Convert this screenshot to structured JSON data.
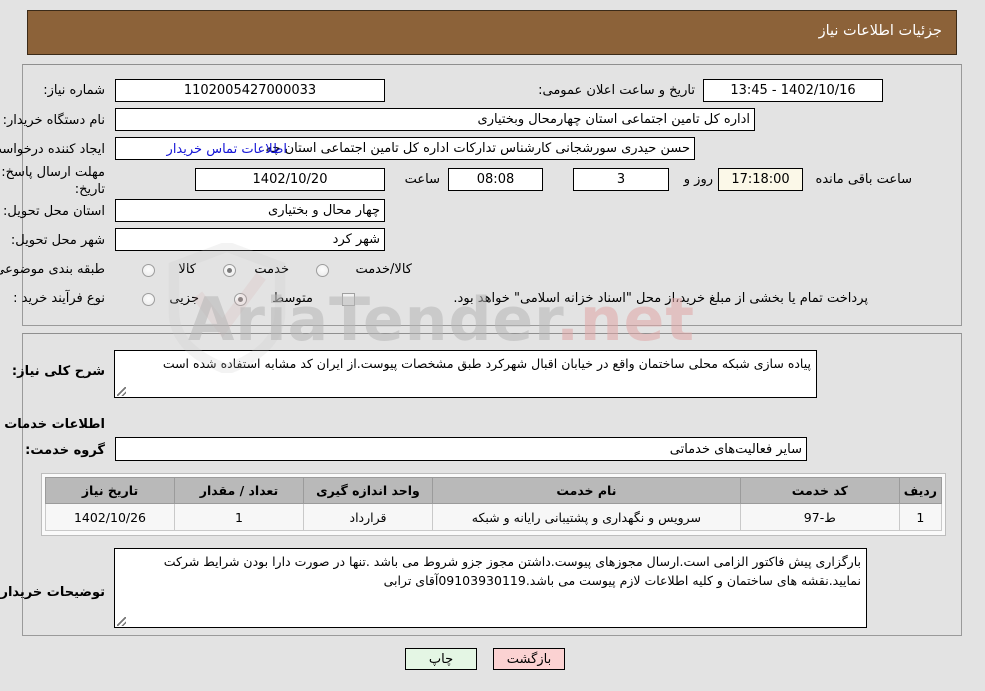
{
  "header": {
    "title": "جزئیات اطلاعات نیاز"
  },
  "watermark": {
    "text": "AriaTender",
    "suffix": ".net"
  },
  "form": {
    "need_number_label": "شماره نیاز:",
    "need_number_value": "1102005427000033",
    "announce_label": "تاریخ و ساعت اعلان عمومی:",
    "announce_value": "1402/10/16 - 13:45",
    "buyer_org_label": "نام دستگاه خریدار:",
    "buyer_org_value": "اداره کل تامین اجتماعی استان چهارمحال وبختیاری",
    "creator_label": "ایجاد کننده درخواست:",
    "creator_value": "حسن حیدری سورشجانی کارشناس تدارکات اداره کل تامین اجتماعی استان چه",
    "contact_link": "اطلاعات تماس خریدار",
    "deadline_label_1": "مهلت ارسال پاسخ: تا",
    "deadline_label_2": "تاریخ:",
    "deadline_date": "1402/10/20",
    "deadline_time_label": "ساعت",
    "deadline_time": "08:08",
    "days_left": "3",
    "days_label": "روز و",
    "hours_left": "17:18:00",
    "hours_label": "ساعت باقی مانده",
    "province_label": "استان محل تحویل:",
    "province_value": "چهار محال و بختیاری",
    "city_label": "شهر محل تحویل:",
    "city_value": "شهر کرد",
    "classification_label": "طبقه بندی موضوعی:",
    "classification_options": [
      "کالا",
      "خدمت",
      "کالا/خدمت"
    ],
    "classification_selected": "خدمت",
    "process_label": "نوع فرآیند خرید :",
    "process_options": [
      "جزیی",
      "متوسط"
    ],
    "process_selected": "متوسط",
    "treasury_note": "پرداخت تمام یا بخشی از مبلغ خرید،از محل \"اسناد خزانه اسلامی\" خواهد بود.",
    "treasury_checked": false
  },
  "description": {
    "label": "شرح کلی نیاز:",
    "value": "پیاده سازی شبکه محلی ساختمان واقع در خیابان اقبال شهرکرد طبق مشخصات پیوست.از ایران کد مشابه استفاده شده است",
    "section_title": "اطلاعات خدمات مورد نیاز",
    "service_group_label": "گروه خدمت:",
    "service_group_value": "سایر فعالیت‌های خدماتی"
  },
  "table": {
    "headers": [
      "ردیف",
      "کد خدمت",
      "نام خدمت",
      "واحد اندازه گیری",
      "تعداد / مقدار",
      "تاریخ نیاز"
    ],
    "rows": [
      {
        "row": "1",
        "service_code": "ط-97",
        "service_name": "سرویس و نگهداری و پشتیبانی رایانه و شبکه",
        "unit": "قرارداد",
        "quantity": "1",
        "need_date": "1402/10/26"
      }
    ]
  },
  "notes": {
    "label": "توضیحات خریدار:",
    "value": "بارگزاری پیش فاکتور الزامی است.ارسال مجوزهای پیوست.داشتن مجوز جزو شروط می باشد .تنها در صورت دارا بودن شرایط شرکت نمایید.نقشه های ساختمان و کلیه اطلاعات لازم پیوست می باشد.09103930119آقای ترابی"
  },
  "buttons": {
    "print": "چاپ",
    "back": "بازگشت"
  }
}
